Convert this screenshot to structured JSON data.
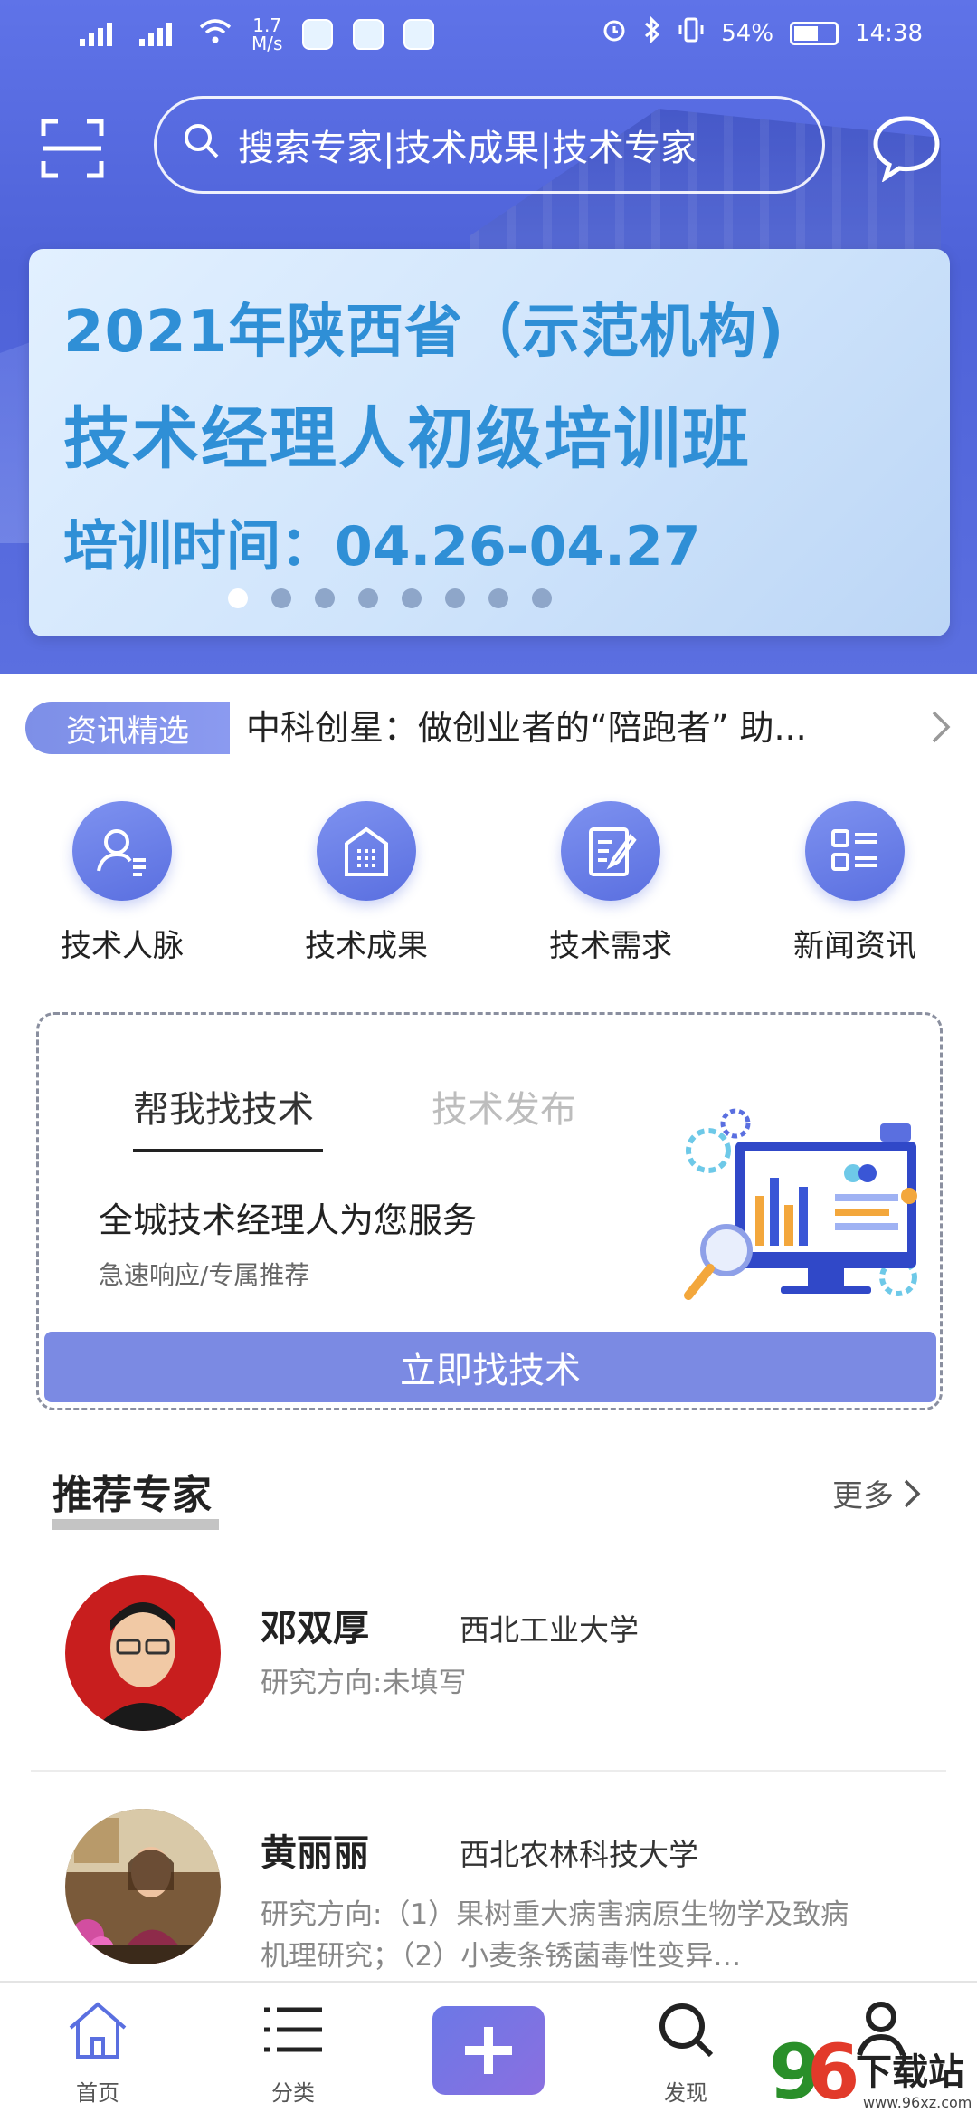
{
  "status_bar": {
    "net1": "4G",
    "net2": "4G",
    "speed_value": "1.7",
    "speed_unit": "M/s",
    "battery": "54%",
    "time": "14:38"
  },
  "search": {
    "placeholder": "搜索专家|技术成果|技术专家"
  },
  "banner": {
    "line1": "2021年陕西省（示范机构)",
    "line2": "技术经理人初级培训班",
    "line3": "培训时间：04.26-04.27",
    "slide_count": 8,
    "active_index": 0
  },
  "news": {
    "tag": "资讯精选",
    "headline": "中科创星：做创业者的“陪跑者” 助..."
  },
  "quick_links": [
    {
      "label": "技术人脉",
      "icon": "contact-icon"
    },
    {
      "label": "技术成果",
      "icon": "building-icon"
    },
    {
      "label": "技术需求",
      "icon": "edit-note-icon"
    },
    {
      "label": "新闻资讯",
      "icon": "list-icon"
    }
  ],
  "help_card": {
    "tab_active": "帮我找技术",
    "tab_inactive": "技术发布",
    "headline": "全城技术经理人为您服务",
    "subtext": "急速响应/专属推荐",
    "cta": "立即找技术"
  },
  "experts_section": {
    "title": "推荐专家",
    "more": "更多",
    "experts": [
      {
        "name": "邓双厚",
        "university": "西北工业大学",
        "field": "研究方向:未填写"
      },
      {
        "name": "黄丽丽",
        "university": "西北农林科技大学",
        "field": "研究方向:（1）果树重大病害病原生物学及致病机理研究；（2）小麦条锈菌毒性变异…"
      }
    ]
  },
  "bottom_nav": [
    {
      "label": "首页",
      "icon": "home-icon",
      "active": true
    },
    {
      "label": "分类",
      "icon": "menu-icon",
      "active": false
    },
    {
      "label": "",
      "icon": "plus-icon",
      "active": false
    },
    {
      "label": "发现",
      "icon": "search-icon",
      "active": false
    },
    {
      "label": "",
      "icon": "user-icon",
      "active": false
    }
  ],
  "watermark": {
    "brand": "96下载站",
    "url": "www.96xz.com"
  },
  "colors": {
    "brand": "#5a6fe0",
    "cta": "#7b8ae3",
    "banner_text": "#2f8fd6"
  }
}
